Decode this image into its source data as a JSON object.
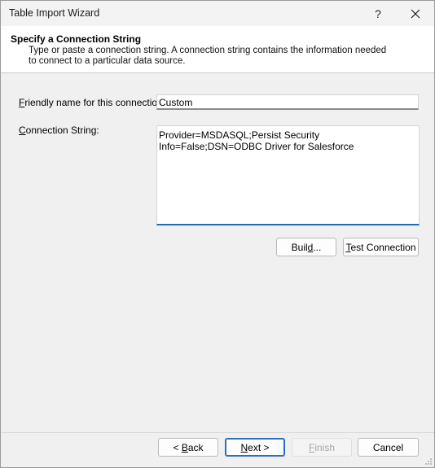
{
  "window": {
    "title": "Table Import Wizard"
  },
  "header": {
    "title": "Specify a Connection String",
    "subtitle": "Type or paste a connection string. A connection string contains the information needed to connect to a particular data source."
  },
  "form": {
    "friendly_name_label": "Friendly name for this connection:",
    "friendly_name_value": "Custom",
    "connection_string_label": "Connection String:",
    "connection_string_value": "Provider=MSDASQL;Persist Security Info=False;DSN=ODBC Driver for Salesforce"
  },
  "buttons": {
    "build": "Build...",
    "test_connection": "Test Connection",
    "back": "< Back",
    "next": "Next >",
    "finish": "Finish",
    "cancel": "Cancel"
  },
  "icons": {
    "help": "help-icon",
    "close": "close-icon",
    "resize": "resize-grip-icon"
  }
}
